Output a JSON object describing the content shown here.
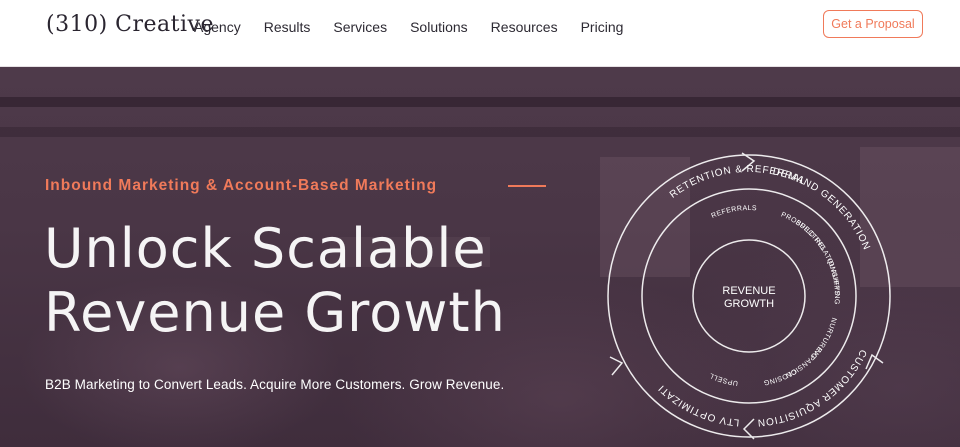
{
  "header": {
    "logo": "(310) Creative",
    "nav": [
      "Agency",
      "Results",
      "Services",
      "Solutions",
      "Resources",
      "Pricing"
    ],
    "cta_label": "Get a Proposal"
  },
  "hero": {
    "eyebrow": "Inbound Marketing & Account-Based Marketing",
    "headline_line1": "Unlock Scalable",
    "headline_line2": "Revenue Growth",
    "subheadline": "B2B Marketing to Convert Leads. Acquire More Customers. Grow Revenue."
  },
  "diagram": {
    "center_line1": "REVENUE",
    "center_line2": "GROWTH",
    "outer_segments": [
      "DEMAND GENERATION",
      "CUSTOMER AQUISITION",
      "LTV OPTIMIZATION",
      "RETENTION & REFERRAL"
    ],
    "inner_stages": [
      "PROSPECTING",
      "QUALIFYING",
      "NURTURING",
      "CLOSING",
      "UPSELL",
      "EXPANSION",
      "BUILD RELATIONSHIPS",
      "REFERRALS"
    ]
  },
  "colors": {
    "accent": "#f07a5a",
    "hero_overlay": "#4a3646",
    "text_dark": "#2d2a33"
  }
}
